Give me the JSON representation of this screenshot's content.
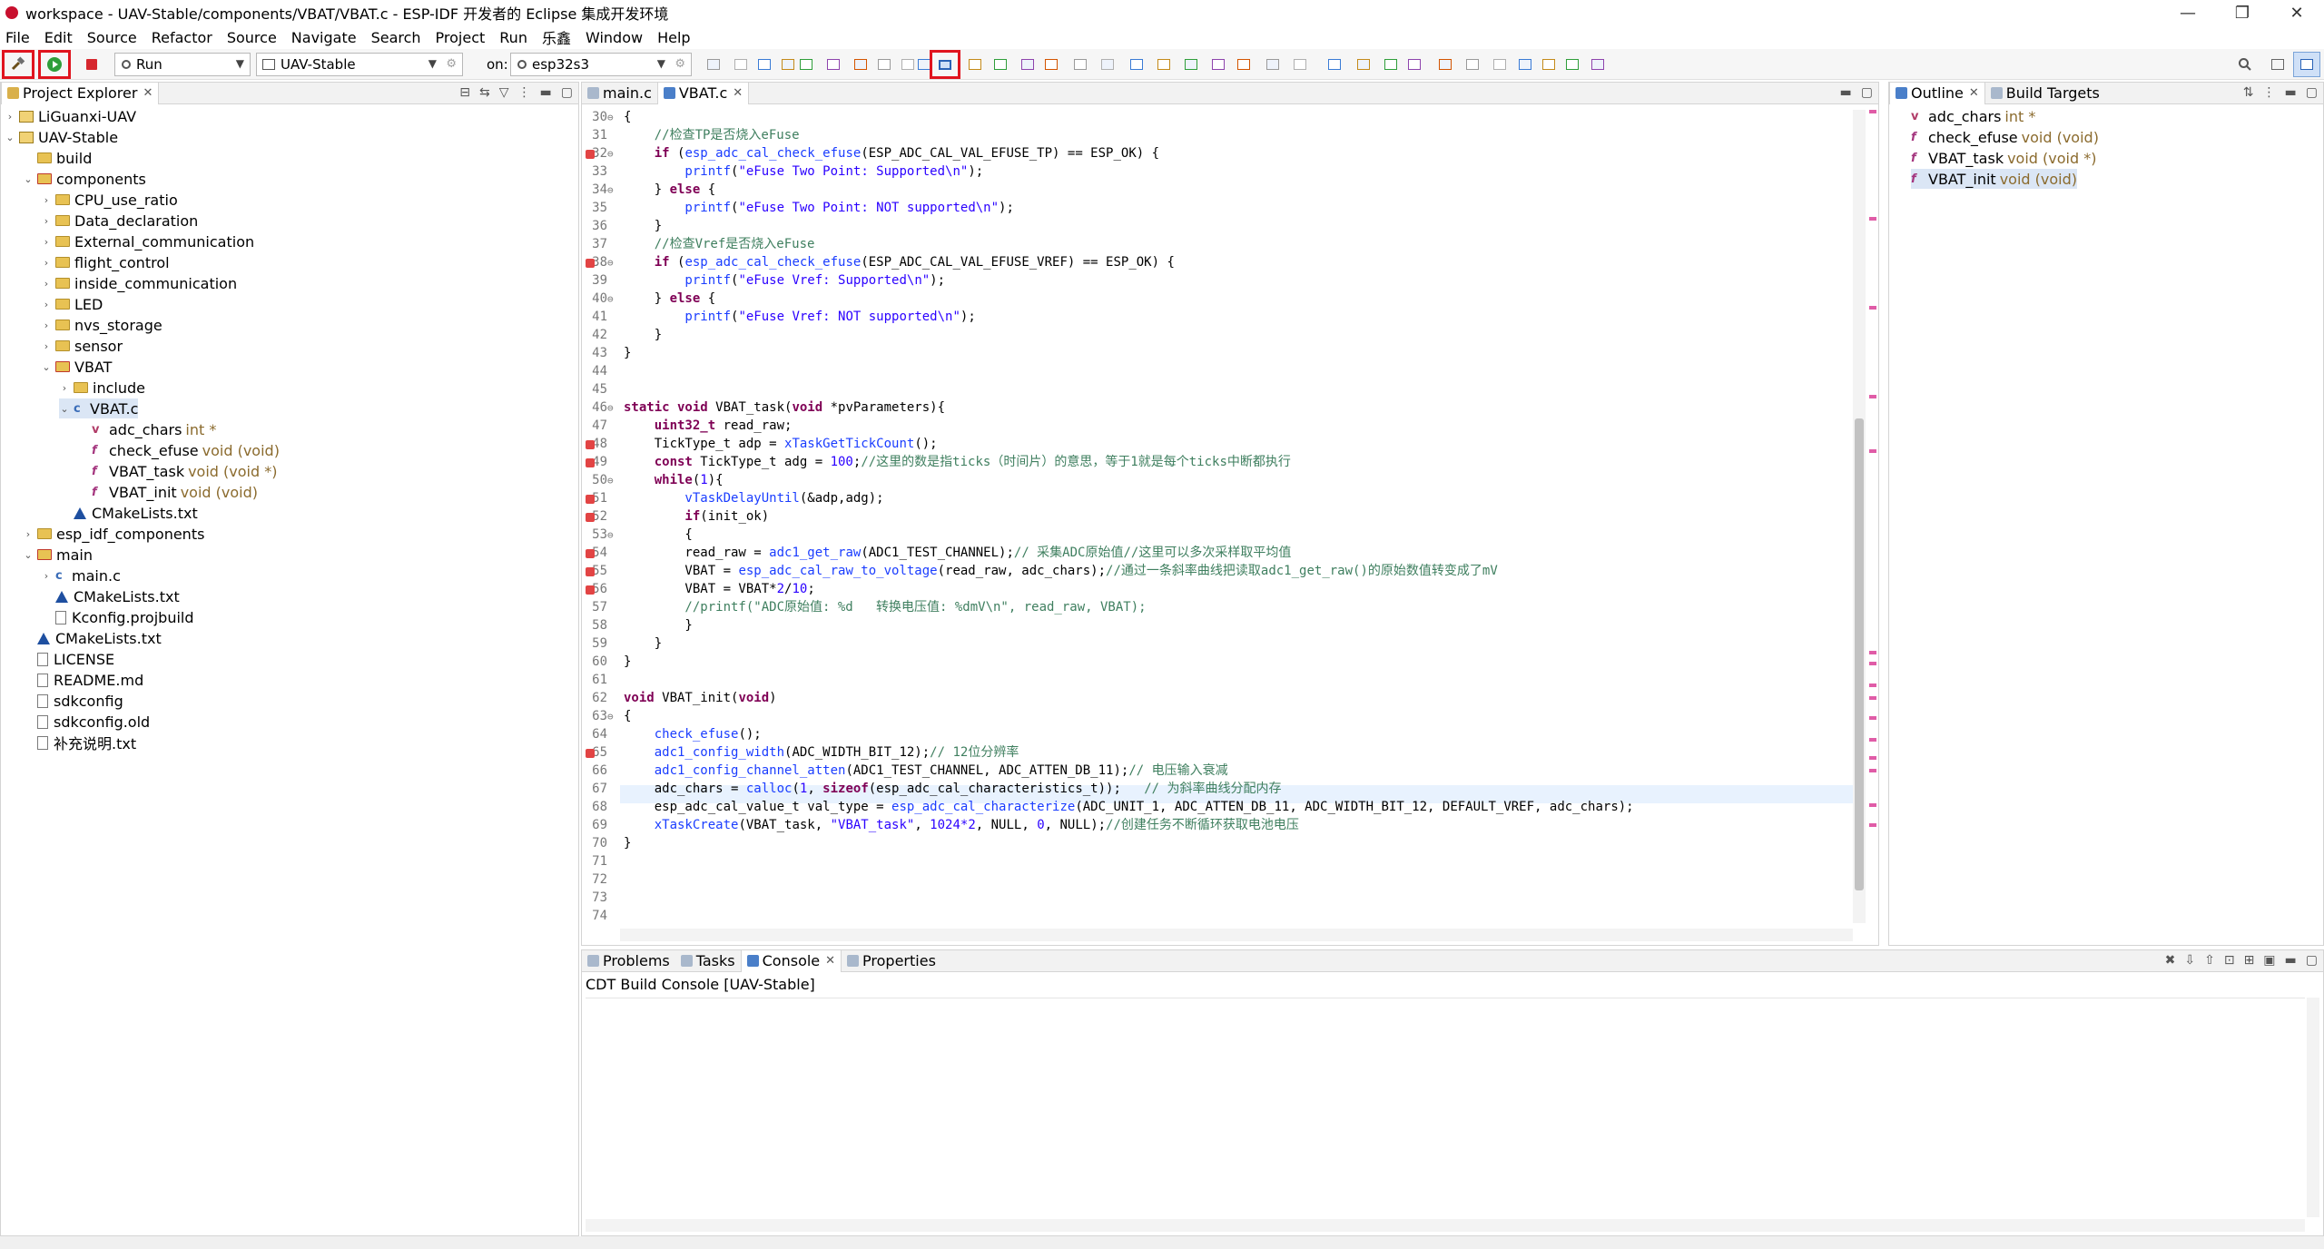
{
  "window": {
    "title": "workspace - UAV-Stable/components/VBAT/VBAT.c - ESP-IDF 开发者的 Eclipse 集成开发环境",
    "minimize": "—",
    "maximize": "❐",
    "close": "✕"
  },
  "menu": [
    "File",
    "Edit",
    "Source",
    "Refactor",
    "Source",
    "Navigate",
    "Search",
    "Project",
    "Run",
    "乐鑫",
    "Window",
    "Help"
  ],
  "toolbar": {
    "mode_combo": "Run",
    "project_combo": "UAV-Stable",
    "on_label": "on:",
    "target_combo": "esp32s3",
    "accent_highlight": "#e0141e"
  },
  "project_explorer": {
    "tab_label": "Project Explorer",
    "items": [
      {
        "label": "LiGuanxi-UAV",
        "type": "project",
        "depth": 0,
        "expanded": false
      },
      {
        "label": "UAV-Stable",
        "type": "project",
        "depth": 0,
        "expanded": true
      },
      {
        "label": "build",
        "type": "folder",
        "depth": 1,
        "expanded": null
      },
      {
        "label": "components",
        "type": "folder-src",
        "depth": 1,
        "expanded": true
      },
      {
        "label": "CPU_use_ratio",
        "type": "folder",
        "depth": 2,
        "expanded": false
      },
      {
        "label": "Data_declaration",
        "type": "folder",
        "depth": 2,
        "expanded": false
      },
      {
        "label": "External_communication",
        "type": "folder",
        "depth": 2,
        "expanded": false
      },
      {
        "label": "flight_control",
        "type": "folder",
        "depth": 2,
        "expanded": false
      },
      {
        "label": "inside_communication",
        "type": "folder",
        "depth": 2,
        "expanded": false
      },
      {
        "label": "LED",
        "type": "folder",
        "depth": 2,
        "expanded": false
      },
      {
        "label": "nvs_storage",
        "type": "folder",
        "depth": 2,
        "expanded": false
      },
      {
        "label": "sensor",
        "type": "folder",
        "depth": 2,
        "expanded": false
      },
      {
        "label": "VBAT",
        "type": "folder-src",
        "depth": 2,
        "expanded": true
      },
      {
        "label": "include",
        "type": "folder",
        "depth": 3,
        "expanded": false
      },
      {
        "label": "VBAT.c",
        "type": "cfile",
        "depth": 3,
        "expanded": true,
        "selected": true
      },
      {
        "label": "adc_chars",
        "sig": "int *",
        "type": "var",
        "depth": 4
      },
      {
        "label": "check_efuse",
        "sig": "void (void)",
        "type": "fn",
        "depth": 4
      },
      {
        "label": "VBAT_task",
        "sig": "void (void *)",
        "type": "fn",
        "depth": 4
      },
      {
        "label": "VBAT_init",
        "sig": "void (void)",
        "type": "fn",
        "depth": 4
      },
      {
        "label": "CMakeLists.txt",
        "type": "cmake",
        "depth": 3
      },
      {
        "label": "esp_idf_components",
        "type": "folder",
        "depth": 1,
        "expanded": false
      },
      {
        "label": "main",
        "type": "folder-src",
        "depth": 1,
        "expanded": true
      },
      {
        "label": "main.c",
        "type": "cfile",
        "depth": 2,
        "expanded": false
      },
      {
        "label": "CMakeLists.txt",
        "type": "cmake",
        "depth": 2
      },
      {
        "label": "Kconfig.projbuild",
        "type": "file",
        "depth": 2
      },
      {
        "label": "CMakeLists.txt",
        "type": "cmake",
        "depth": 1
      },
      {
        "label": "LICENSE",
        "type": "file",
        "depth": 1
      },
      {
        "label": "README.md",
        "type": "file",
        "depth": 1
      },
      {
        "label": "sdkconfig",
        "type": "file",
        "depth": 1
      },
      {
        "label": "sdkconfig.old",
        "type": "file",
        "depth": 1
      },
      {
        "label": "补充说明.txt",
        "type": "file",
        "depth": 1
      }
    ]
  },
  "editor": {
    "tabs": [
      {
        "label": "main.c",
        "active": false
      },
      {
        "label": "VBAT.c",
        "active": true
      }
    ],
    "current_line": 66,
    "lines": [
      {
        "n": 30,
        "fold": true,
        "marker": false,
        "tokens": [
          [
            "",
            "{"
          ]
        ]
      },
      {
        "n": 31,
        "fold": false,
        "marker": false,
        "tokens": [
          [
            "cm",
            "    //检查TP是否烧入eFuse"
          ]
        ]
      },
      {
        "n": 32,
        "fold": true,
        "marker": true,
        "tokens": [
          [
            "kw",
            "    if"
          ],
          [
            "",
            " ("
          ],
          [
            "fn",
            "esp_adc_cal_check_efuse"
          ],
          [
            "",
            "(ESP_ADC_CAL_VAL_EFUSE_TP) == ESP_OK) {"
          ]
        ]
      },
      {
        "n": 33,
        "fold": false,
        "marker": false,
        "tokens": [
          [
            "fn",
            "        printf"
          ],
          [
            "",
            "("
          ],
          [
            "st",
            "\"eFuse Two Point: Supported\\n\""
          ],
          [
            "",
            ");"
          ]
        ]
      },
      {
        "n": 34,
        "fold": true,
        "marker": false,
        "tokens": [
          [
            "",
            "    } "
          ],
          [
            "kw",
            "else"
          ],
          [
            "",
            " {"
          ]
        ]
      },
      {
        "n": 35,
        "fold": false,
        "marker": false,
        "tokens": [
          [
            "fn",
            "        printf"
          ],
          [
            "",
            "("
          ],
          [
            "st",
            "\"eFuse Two Point: NOT supported\\n\""
          ],
          [
            "",
            ");"
          ]
        ]
      },
      {
        "n": 36,
        "fold": false,
        "marker": false,
        "tokens": [
          [
            "",
            "    }"
          ]
        ]
      },
      {
        "n": 37,
        "fold": false,
        "marker": false,
        "tokens": [
          [
            "cm",
            "    //检查Vref是否烧入eFuse"
          ]
        ]
      },
      {
        "n": 38,
        "fold": true,
        "marker": true,
        "tokens": [
          [
            "kw",
            "    if"
          ],
          [
            "",
            " ("
          ],
          [
            "fn",
            "esp_adc_cal_check_efuse"
          ],
          [
            "",
            "(ESP_ADC_CAL_VAL_EFUSE_VREF) == ESP_OK) {"
          ]
        ]
      },
      {
        "n": 39,
        "fold": false,
        "marker": false,
        "tokens": [
          [
            "fn",
            "        printf"
          ],
          [
            "",
            "("
          ],
          [
            "st",
            "\"eFuse Vref: Supported\\n\""
          ],
          [
            "",
            ");"
          ]
        ]
      },
      {
        "n": 40,
        "fold": true,
        "marker": false,
        "tokens": [
          [
            "",
            "    } "
          ],
          [
            "kw",
            "else"
          ],
          [
            "",
            " {"
          ]
        ]
      },
      {
        "n": 41,
        "fold": false,
        "marker": false,
        "tokens": [
          [
            "fn",
            "        printf"
          ],
          [
            "",
            "("
          ],
          [
            "st",
            "\"eFuse Vref: NOT supported\\n\""
          ],
          [
            "",
            ");"
          ]
        ]
      },
      {
        "n": 42,
        "fold": false,
        "marker": false,
        "tokens": [
          [
            "",
            "    }"
          ]
        ]
      },
      {
        "n": 43,
        "fold": false,
        "marker": false,
        "tokens": [
          [
            "",
            "}"
          ]
        ]
      },
      {
        "n": 44,
        "fold": false,
        "marker": false,
        "tokens": [
          [
            "",
            ""
          ]
        ]
      },
      {
        "n": 45,
        "fold": false,
        "marker": false,
        "tokens": [
          [
            "",
            ""
          ]
        ]
      },
      {
        "n": 46,
        "fold": true,
        "marker": false,
        "tokens": [
          [
            "kw",
            "static void"
          ],
          [
            "",
            " VBAT_task("
          ],
          [
            "kw",
            "void"
          ],
          [
            "",
            " *pvParameters){"
          ]
        ]
      },
      {
        "n": 47,
        "fold": false,
        "marker": false,
        "tokens": [
          [
            "kw",
            "    uint32_t"
          ],
          [
            "",
            " read_raw;"
          ]
        ]
      },
      {
        "n": 48,
        "fold": false,
        "marker": true,
        "tokens": [
          [
            "",
            "    TickType_t adp = "
          ],
          [
            "fn",
            "xTaskGetTickCount"
          ],
          [
            "",
            "();"
          ]
        ]
      },
      {
        "n": 49,
        "fold": false,
        "marker": true,
        "tokens": [
          [
            "kw",
            "    const"
          ],
          [
            "",
            " TickType_t adg = "
          ],
          [
            "st",
            "100"
          ],
          [
            "",
            ";"
          ],
          [
            "cm",
            "//这里的数是指ticks（时间片）的意思，等于1就是每个ticks中断都执行"
          ]
        ]
      },
      {
        "n": 50,
        "fold": true,
        "marker": false,
        "tokens": [
          [
            "kw",
            "    while"
          ],
          [
            "",
            "("
          ],
          [
            "st",
            "1"
          ],
          [
            "",
            "){"
          ]
        ]
      },
      {
        "n": 51,
        "fold": false,
        "marker": true,
        "tokens": [
          [
            "fn",
            "        vTaskDelayUntil"
          ],
          [
            "",
            "(&adp,adg);"
          ]
        ]
      },
      {
        "n": 52,
        "fold": false,
        "marker": true,
        "tokens": [
          [
            "kw",
            "        if"
          ],
          [
            "",
            "(init_ok)"
          ]
        ]
      },
      {
        "n": 53,
        "fold": true,
        "marker": false,
        "tokens": [
          [
            "",
            "        {"
          ]
        ]
      },
      {
        "n": 54,
        "fold": false,
        "marker": true,
        "tokens": [
          [
            "",
            "        read_raw = "
          ],
          [
            "fn",
            "adc1_get_raw"
          ],
          [
            "",
            "(ADC1_TEST_CHANNEL);"
          ],
          [
            "cm",
            "// 采集ADC原始值//这里可以多次采样取平均值"
          ]
        ]
      },
      {
        "n": 55,
        "fold": false,
        "marker": true,
        "tokens": [
          [
            "",
            "        VBAT = "
          ],
          [
            "fn",
            "esp_adc_cal_raw_to_voltage"
          ],
          [
            "",
            "(read_raw, adc_chars);"
          ],
          [
            "cm",
            "//通过一条斜率曲线把读取adc1_get_raw()的原始数值转变成了mV"
          ]
        ]
      },
      {
        "n": 56,
        "fold": false,
        "marker": true,
        "tokens": [
          [
            "",
            "        VBAT = VBAT*"
          ],
          [
            "st",
            "2"
          ],
          [
            "",
            "/"
          ],
          [
            "st",
            "10"
          ],
          [
            "",
            ";"
          ]
        ]
      },
      {
        "n": 57,
        "fold": false,
        "marker": false,
        "tokens": [
          [
            "cm",
            "        //printf(\"ADC原始值: %d   转换电压值: %dmV\\n\", read_raw, VBAT);"
          ]
        ]
      },
      {
        "n": 58,
        "fold": false,
        "marker": false,
        "tokens": [
          [
            "",
            "        }"
          ]
        ]
      },
      {
        "n": 59,
        "fold": false,
        "marker": false,
        "tokens": [
          [
            "",
            "    }"
          ]
        ]
      },
      {
        "n": 60,
        "fold": false,
        "marker": false,
        "tokens": [
          [
            "",
            "}"
          ]
        ]
      },
      {
        "n": 61,
        "fold": false,
        "marker": false,
        "tokens": [
          [
            "",
            ""
          ]
        ]
      },
      {
        "n": 62,
        "fold": false,
        "marker": false,
        "tokens": [
          [
            "kw",
            "void"
          ],
          [
            "",
            " VBAT_init("
          ],
          [
            "kw",
            "void"
          ],
          [
            "",
            ")"
          ]
        ]
      },
      {
        "n": 63,
        "fold": true,
        "marker": false,
        "tokens": [
          [
            "",
            "{"
          ]
        ]
      },
      {
        "n": 64,
        "fold": false,
        "marker": false,
        "tokens": [
          [
            "fn",
            "    check_efuse"
          ],
          [
            "",
            "();"
          ]
        ]
      },
      {
        "n": 65,
        "fold": false,
        "marker": true,
        "tokens": [
          [
            "fn",
            "    adc1_config_width"
          ],
          [
            "",
            "(ADC_WIDTH_BIT_12);"
          ],
          [
            "cm",
            "// 12位分辨率"
          ]
        ]
      },
      {
        "n": 66,
        "fold": false,
        "marker": false,
        "tokens": [
          [
            "fn",
            "    adc1_config_channel_atten"
          ],
          [
            "",
            "(ADC1_TEST_CHANNEL, ADC_ATTEN_DB_11);"
          ],
          [
            "cm",
            "// 电压输入衰减"
          ]
        ]
      },
      {
        "n": 67,
        "fold": false,
        "marker": false,
        "tokens": [
          [
            "",
            "    adc_chars = "
          ],
          [
            "fn",
            "calloc"
          ],
          [
            "",
            "("
          ],
          [
            "st",
            "1"
          ],
          [
            "",
            ", "
          ],
          [
            "kw",
            "sizeof"
          ],
          [
            "",
            "(esp_adc_cal_characteristics_t));   "
          ],
          [
            "cm",
            "// 为斜率曲线分配内存"
          ]
        ]
      },
      {
        "n": 68,
        "fold": false,
        "marker": false,
        "tokens": [
          [
            "",
            "    esp_adc_cal_value_t val_type = "
          ],
          [
            "fn",
            "esp_adc_cal_characterize"
          ],
          [
            "",
            "(ADC_UNIT_1, ADC_ATTEN_DB_11, ADC_WIDTH_BIT_12, DEFAULT_VREF, adc_chars);"
          ]
        ]
      },
      {
        "n": 69,
        "fold": false,
        "marker": false,
        "tokens": [
          [
            "fn",
            "    xTaskCreate"
          ],
          [
            "",
            "(VBAT_task, "
          ],
          [
            "st",
            "\"VBAT_task\""
          ],
          [
            "",
            ", "
          ],
          [
            "st",
            "1024*2"
          ],
          [
            "",
            ", NULL, "
          ],
          [
            "st",
            "0"
          ],
          [
            "",
            ", NULL);"
          ],
          [
            "cm",
            "//创建任务不断循环获取电池电压"
          ]
        ]
      },
      {
        "n": 70,
        "fold": false,
        "marker": false,
        "tokens": [
          [
            "",
            "}"
          ]
        ]
      },
      {
        "n": 71,
        "fold": false,
        "marker": false,
        "tokens": [
          [
            "",
            ""
          ]
        ]
      },
      {
        "n": 72,
        "fold": false,
        "marker": false,
        "tokens": [
          [
            "",
            ""
          ]
        ]
      },
      {
        "n": 73,
        "fold": false,
        "marker": false,
        "tokens": [
          [
            "",
            ""
          ]
        ]
      },
      {
        "n": 74,
        "fold": false,
        "marker": false,
        "tokens": [
          [
            "",
            ""
          ]
        ]
      }
    ]
  },
  "outline": {
    "tabs": [
      {
        "label": "Outline",
        "active": true
      },
      {
        "label": "Build Targets",
        "active": false
      }
    ],
    "items": [
      {
        "label": "adc_chars",
        "sig": "int *",
        "type": "var",
        "selected": false
      },
      {
        "label": "check_efuse",
        "sig": "void (void)",
        "type": "fn",
        "selected": false
      },
      {
        "label": "VBAT_task",
        "sig": "void (void *)",
        "type": "fn",
        "selected": false
      },
      {
        "label": "VBAT_init",
        "sig": "void (void)",
        "type": "fn",
        "selected": true
      }
    ]
  },
  "console": {
    "tabs": [
      {
        "label": "Problems",
        "active": false
      },
      {
        "label": "Tasks",
        "active": false
      },
      {
        "label": "Console",
        "active": true
      },
      {
        "label": "Properties",
        "active": false
      }
    ],
    "header": "CDT Build Console [UAV-Stable]"
  }
}
